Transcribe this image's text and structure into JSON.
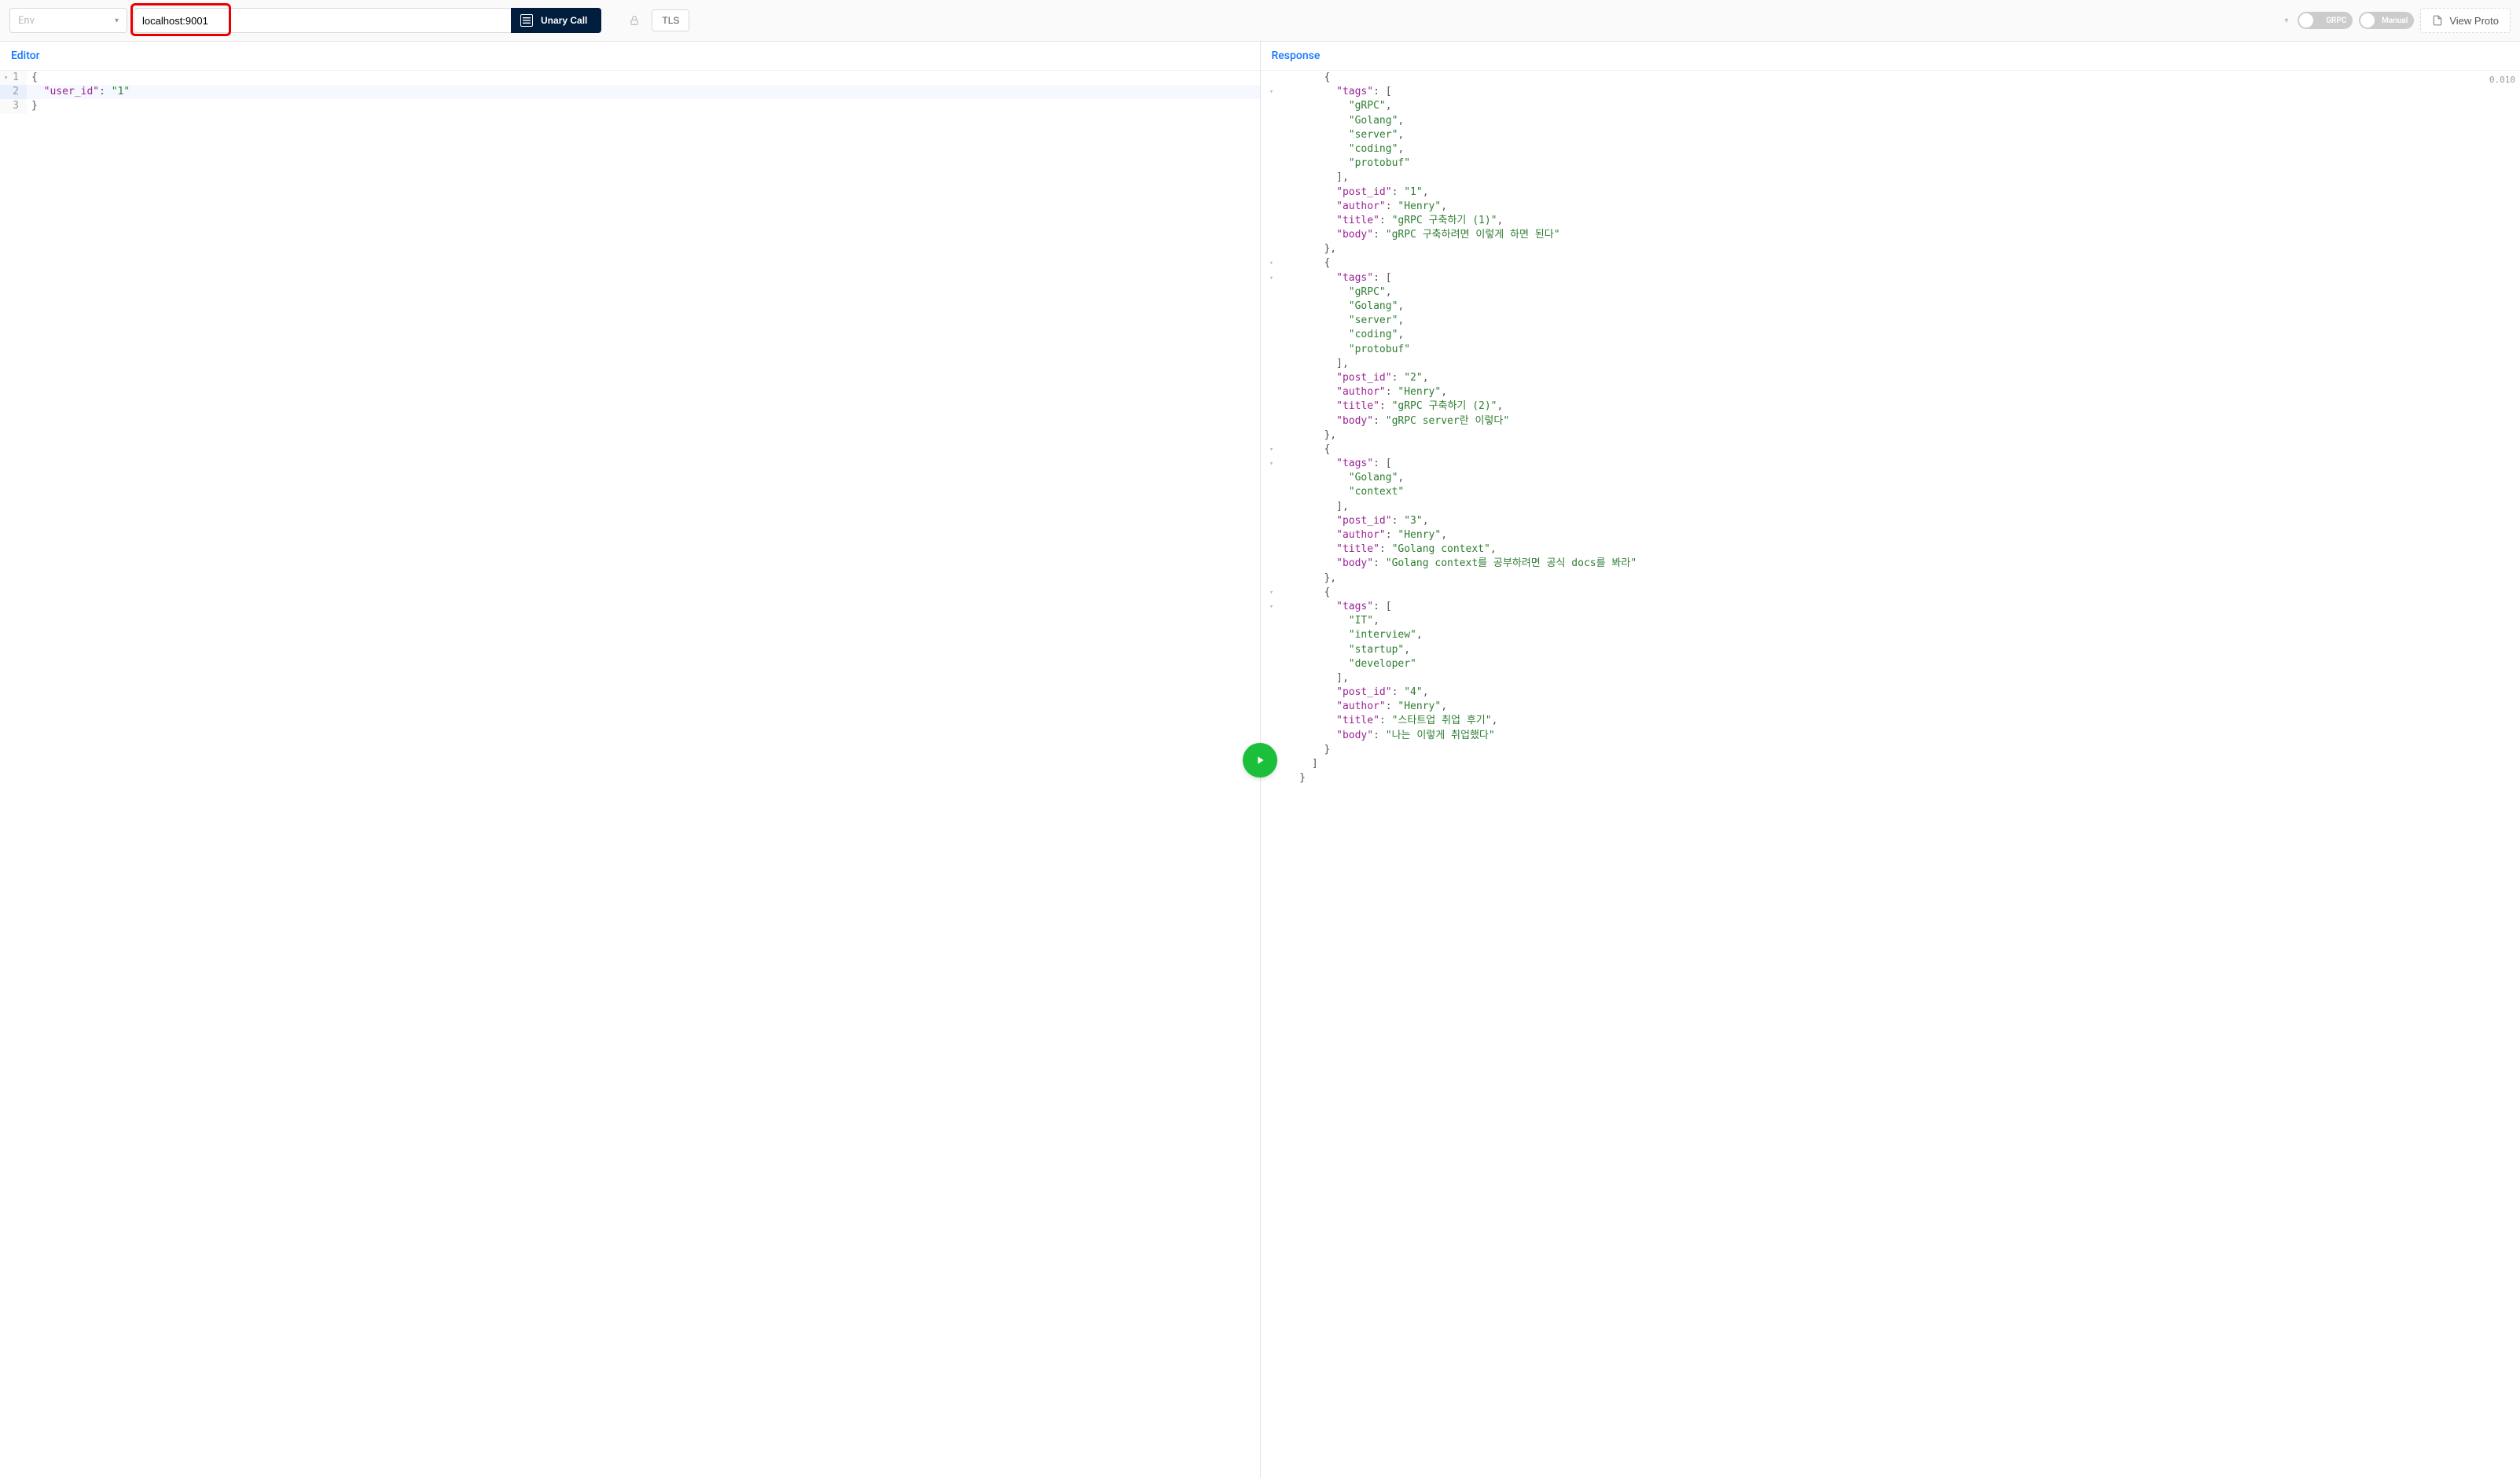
{
  "toolbar": {
    "env_placeholder": "Env",
    "url": "localhost:9001",
    "call_type": "Unary Call",
    "tls_label": "TLS",
    "toggle_grpc": "GRPC",
    "toggle_manual": "Manual",
    "view_proto": "View Proto"
  },
  "editor": {
    "title": "Editor",
    "lines": [
      {
        "n": "1",
        "fold": true,
        "tokens": [
          [
            "punc",
            "{"
          ]
        ]
      },
      {
        "n": "2",
        "active": true,
        "tokens": [
          [
            "indent",
            "  "
          ],
          [
            "key",
            "\"user_id\""
          ],
          [
            "punc",
            ": "
          ],
          [
            "str",
            "\"1\""
          ]
        ]
      },
      {
        "n": "3",
        "tokens": [
          [
            "punc",
            "}"
          ]
        ]
      }
    ]
  },
  "response": {
    "title": "Response",
    "timing": "0.010",
    "lines": [
      {
        "fold": "",
        "tokens": [
          [
            "indent",
            "      "
          ],
          [
            "punc",
            "{"
          ]
        ]
      },
      {
        "fold": "▾",
        "tokens": [
          [
            "indent",
            "        "
          ],
          [
            "key",
            "\"tags\""
          ],
          [
            "punc",
            ": ["
          ]
        ]
      },
      {
        "tokens": [
          [
            "indent",
            "          "
          ],
          [
            "str",
            "\"gRPC\""
          ],
          [
            "punc",
            ","
          ]
        ]
      },
      {
        "tokens": [
          [
            "indent",
            "          "
          ],
          [
            "str",
            "\"Golang\""
          ],
          [
            "punc",
            ","
          ]
        ]
      },
      {
        "tokens": [
          [
            "indent",
            "          "
          ],
          [
            "str",
            "\"server\""
          ],
          [
            "punc",
            ","
          ]
        ]
      },
      {
        "tokens": [
          [
            "indent",
            "          "
          ],
          [
            "str",
            "\"coding\""
          ],
          [
            "punc",
            ","
          ]
        ]
      },
      {
        "tokens": [
          [
            "indent",
            "          "
          ],
          [
            "str",
            "\"protobuf\""
          ]
        ]
      },
      {
        "tokens": [
          [
            "indent",
            "        "
          ],
          [
            "punc",
            "],"
          ]
        ]
      },
      {
        "tokens": [
          [
            "indent",
            "        "
          ],
          [
            "key",
            "\"post_id\""
          ],
          [
            "punc",
            ": "
          ],
          [
            "str",
            "\"1\""
          ],
          [
            "punc",
            ","
          ]
        ]
      },
      {
        "tokens": [
          [
            "indent",
            "        "
          ],
          [
            "key",
            "\"author\""
          ],
          [
            "punc",
            ": "
          ],
          [
            "str",
            "\"Henry\""
          ],
          [
            "punc",
            ","
          ]
        ]
      },
      {
        "tokens": [
          [
            "indent",
            "        "
          ],
          [
            "key",
            "\"title\""
          ],
          [
            "punc",
            ": "
          ],
          [
            "str",
            "\"gRPC 구축하기 (1)\""
          ],
          [
            "punc",
            ","
          ]
        ]
      },
      {
        "tokens": [
          [
            "indent",
            "        "
          ],
          [
            "key",
            "\"body\""
          ],
          [
            "punc",
            ": "
          ],
          [
            "str",
            "\"gRPC 구축하려면 이렇게 하면 된다\""
          ]
        ]
      },
      {
        "tokens": [
          [
            "indent",
            "      "
          ],
          [
            "punc",
            "},"
          ]
        ]
      },
      {
        "fold": "▾",
        "tokens": [
          [
            "indent",
            "      "
          ],
          [
            "punc",
            "{"
          ]
        ]
      },
      {
        "fold": "▾",
        "tokens": [
          [
            "indent",
            "        "
          ],
          [
            "key",
            "\"tags\""
          ],
          [
            "punc",
            ": ["
          ]
        ]
      },
      {
        "tokens": [
          [
            "indent",
            "          "
          ],
          [
            "str",
            "\"gRPC\""
          ],
          [
            "punc",
            ","
          ]
        ]
      },
      {
        "tokens": [
          [
            "indent",
            "          "
          ],
          [
            "str",
            "\"Golang\""
          ],
          [
            "punc",
            ","
          ]
        ]
      },
      {
        "tokens": [
          [
            "indent",
            "          "
          ],
          [
            "str",
            "\"server\""
          ],
          [
            "punc",
            ","
          ]
        ]
      },
      {
        "tokens": [
          [
            "indent",
            "          "
          ],
          [
            "str",
            "\"coding\""
          ],
          [
            "punc",
            ","
          ]
        ]
      },
      {
        "tokens": [
          [
            "indent",
            "          "
          ],
          [
            "str",
            "\"protobuf\""
          ]
        ]
      },
      {
        "tokens": [
          [
            "indent",
            "        "
          ],
          [
            "punc",
            "],"
          ]
        ]
      },
      {
        "tokens": [
          [
            "indent",
            "        "
          ],
          [
            "key",
            "\"post_id\""
          ],
          [
            "punc",
            ": "
          ],
          [
            "str",
            "\"2\""
          ],
          [
            "punc",
            ","
          ]
        ]
      },
      {
        "tokens": [
          [
            "indent",
            "        "
          ],
          [
            "key",
            "\"author\""
          ],
          [
            "punc",
            ": "
          ],
          [
            "str",
            "\"Henry\""
          ],
          [
            "punc",
            ","
          ]
        ]
      },
      {
        "tokens": [
          [
            "indent",
            "        "
          ],
          [
            "key",
            "\"title\""
          ],
          [
            "punc",
            ": "
          ],
          [
            "str",
            "\"gRPC 구축하기 (2)\""
          ],
          [
            "punc",
            ","
          ]
        ]
      },
      {
        "tokens": [
          [
            "indent",
            "        "
          ],
          [
            "key",
            "\"body\""
          ],
          [
            "punc",
            ": "
          ],
          [
            "str",
            "\"gRPC server란 이렇다\""
          ]
        ]
      },
      {
        "tokens": [
          [
            "indent",
            "      "
          ],
          [
            "punc",
            "},"
          ]
        ]
      },
      {
        "fold": "▾",
        "tokens": [
          [
            "indent",
            "      "
          ],
          [
            "punc",
            "{"
          ]
        ]
      },
      {
        "fold": "▾",
        "tokens": [
          [
            "indent",
            "        "
          ],
          [
            "key",
            "\"tags\""
          ],
          [
            "punc",
            ": ["
          ]
        ]
      },
      {
        "tokens": [
          [
            "indent",
            "          "
          ],
          [
            "str",
            "\"Golang\""
          ],
          [
            "punc",
            ","
          ]
        ]
      },
      {
        "tokens": [
          [
            "indent",
            "          "
          ],
          [
            "str",
            "\"context\""
          ]
        ]
      },
      {
        "tokens": [
          [
            "indent",
            "        "
          ],
          [
            "punc",
            "],"
          ]
        ]
      },
      {
        "tokens": [
          [
            "indent",
            "        "
          ],
          [
            "key",
            "\"post_id\""
          ],
          [
            "punc",
            ": "
          ],
          [
            "str",
            "\"3\""
          ],
          [
            "punc",
            ","
          ]
        ]
      },
      {
        "tokens": [
          [
            "indent",
            "        "
          ],
          [
            "key",
            "\"author\""
          ],
          [
            "punc",
            ": "
          ],
          [
            "str",
            "\"Henry\""
          ],
          [
            "punc",
            ","
          ]
        ]
      },
      {
        "tokens": [
          [
            "indent",
            "        "
          ],
          [
            "key",
            "\"title\""
          ],
          [
            "punc",
            ": "
          ],
          [
            "str",
            "\"Golang context\""
          ],
          [
            "punc",
            ","
          ]
        ]
      },
      {
        "tokens": [
          [
            "indent",
            "        "
          ],
          [
            "key",
            "\"body\""
          ],
          [
            "punc",
            ": "
          ],
          [
            "str",
            "\"Golang context를 공부하려면 공식 docs를 봐라\""
          ]
        ]
      },
      {
        "tokens": [
          [
            "indent",
            "      "
          ],
          [
            "punc",
            "},"
          ]
        ]
      },
      {
        "fold": "▾",
        "tokens": [
          [
            "indent",
            "      "
          ],
          [
            "punc",
            "{"
          ]
        ]
      },
      {
        "fold": "▾",
        "tokens": [
          [
            "indent",
            "        "
          ],
          [
            "key",
            "\"tags\""
          ],
          [
            "punc",
            ": ["
          ]
        ]
      },
      {
        "tokens": [
          [
            "indent",
            "          "
          ],
          [
            "str",
            "\"IT\""
          ],
          [
            "punc",
            ","
          ]
        ]
      },
      {
        "tokens": [
          [
            "indent",
            "          "
          ],
          [
            "str",
            "\"interview\""
          ],
          [
            "punc",
            ","
          ]
        ]
      },
      {
        "tokens": [
          [
            "indent",
            "          "
          ],
          [
            "str",
            "\"startup\""
          ],
          [
            "punc",
            ","
          ]
        ]
      },
      {
        "tokens": [
          [
            "indent",
            "          "
          ],
          [
            "str",
            "\"developer\""
          ]
        ]
      },
      {
        "tokens": [
          [
            "indent",
            "        "
          ],
          [
            "punc",
            "],"
          ]
        ]
      },
      {
        "tokens": [
          [
            "indent",
            "        "
          ],
          [
            "key",
            "\"post_id\""
          ],
          [
            "punc",
            ": "
          ],
          [
            "str",
            "\"4\""
          ],
          [
            "punc",
            ","
          ]
        ]
      },
      {
        "tokens": [
          [
            "indent",
            "        "
          ],
          [
            "key",
            "\"author\""
          ],
          [
            "punc",
            ": "
          ],
          [
            "str",
            "\"Henry\""
          ],
          [
            "punc",
            ","
          ]
        ]
      },
      {
        "tokens": [
          [
            "indent",
            "        "
          ],
          [
            "key",
            "\"title\""
          ],
          [
            "punc",
            ": "
          ],
          [
            "str",
            "\"스타트업 취업 후기\""
          ],
          [
            "punc",
            ","
          ]
        ]
      },
      {
        "tokens": [
          [
            "indent",
            "        "
          ],
          [
            "key",
            "\"body\""
          ],
          [
            "punc",
            ": "
          ],
          [
            "str",
            "\"나는 이렇게 취업했다\""
          ]
        ]
      },
      {
        "tokens": [
          [
            "indent",
            "      "
          ],
          [
            "punc",
            "}"
          ]
        ]
      },
      {
        "tokens": [
          [
            "indent",
            "    "
          ],
          [
            "punc",
            "]"
          ]
        ]
      },
      {
        "tokens": [
          [
            "indent",
            "  "
          ],
          [
            "punc",
            "}"
          ]
        ]
      }
    ]
  }
}
